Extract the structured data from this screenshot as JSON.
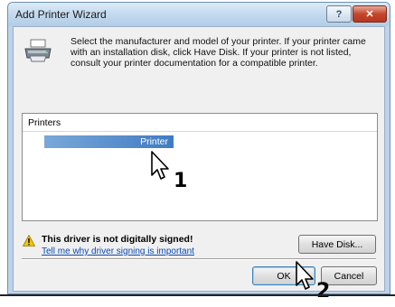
{
  "window": {
    "title": "Add Printer Wizard",
    "help_label": "?",
    "close_label": "✕"
  },
  "description": "Select the manufacturer and model of your printer. If your printer came with an installation disk, click Have Disk. If your printer is not listed, consult your printer documentation for a compatible printer.",
  "printers_list": {
    "header": "Printers",
    "selected_item": "Printer"
  },
  "warning": {
    "title": "This driver is not digitally signed!",
    "link": "Tell me why driver signing is important"
  },
  "buttons": {
    "have_disk": "Have Disk...",
    "ok": "OK",
    "cancel": "Cancel"
  },
  "callouts": {
    "step1": "1",
    "step2": "2"
  }
}
